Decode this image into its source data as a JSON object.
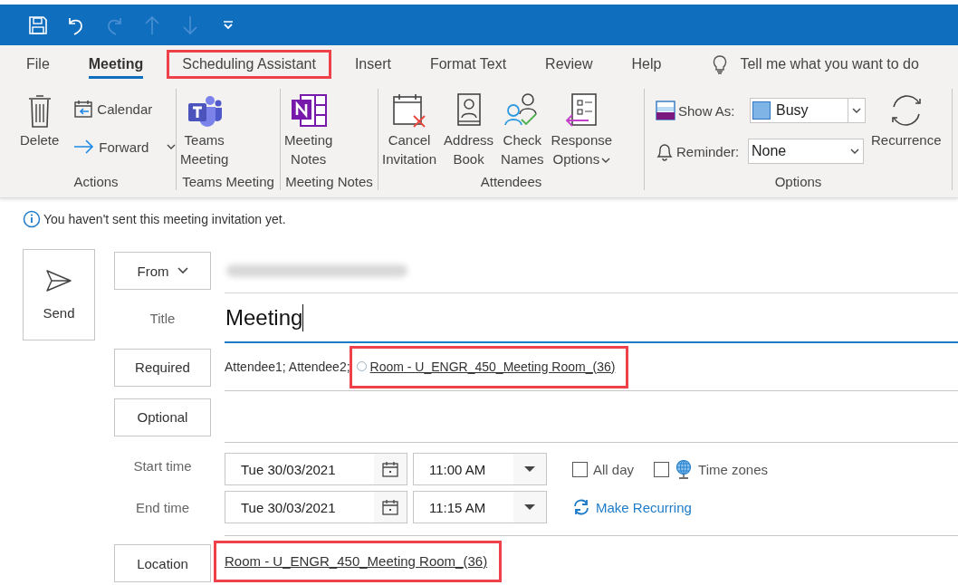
{
  "quick_access": [
    {
      "kind": "save",
      "disabled": false
    },
    {
      "kind": "undo",
      "disabled": false
    },
    {
      "kind": "redo",
      "disabled": true
    },
    {
      "kind": "up",
      "disabled": true
    },
    {
      "kind": "down",
      "disabled": true
    },
    {
      "kind": "customize",
      "disabled": false
    }
  ],
  "tabs": [
    {
      "label": "File",
      "selected": false,
      "highlighted": false
    },
    {
      "label": "Meeting",
      "selected": true,
      "highlighted": false
    },
    {
      "label": "Scheduling Assistant",
      "selected": false,
      "highlighted": true
    },
    {
      "label": "Insert",
      "selected": false,
      "highlighted": false
    },
    {
      "label": "Format Text",
      "selected": false,
      "highlighted": false
    },
    {
      "label": "Review",
      "selected": false,
      "highlighted": false
    },
    {
      "label": "Help",
      "selected": false,
      "highlighted": false
    }
  ],
  "tell_me": "Tell me what you want to do",
  "ribbon_groups": [
    {
      "label": "Actions",
      "items": [
        {
          "kind": "large",
          "label": "Delete",
          "dropdown": false
        },
        {
          "kind": "stack",
          "buttons": [
            {
              "label": "Calendar",
              "dropdown": false
            },
            {
              "label": "Forward",
              "dropdown": true
            }
          ]
        }
      ]
    },
    {
      "label": "Teams Meeting",
      "items": [
        {
          "kind": "large",
          "label": "Teams Meeting",
          "dropdown": false
        }
      ]
    },
    {
      "label": "Meeting Notes",
      "items": [
        {
          "kind": "large",
          "label": "Meeting Notes",
          "dropdown": false
        }
      ]
    },
    {
      "label": "Attendees",
      "items": [
        {
          "kind": "large",
          "label": "Cancel Invitation",
          "dropdown": false
        },
        {
          "kind": "large",
          "label": "Address Book",
          "dropdown": false
        },
        {
          "kind": "large",
          "label": "Check Names",
          "dropdown": false
        },
        {
          "kind": "large",
          "label": "Response Options",
          "dropdown": true
        }
      ]
    },
    {
      "label": "Options",
      "items": [
        {
          "kind": "combos",
          "rows": [
            {
              "label": "Show As:",
              "value": "Busy",
              "swatch": true
            },
            {
              "label": "Reminder:",
              "value": "None",
              "swatch": false
            }
          ]
        },
        {
          "kind": "large",
          "label": "Recurrence",
          "dropdown": false
        }
      ]
    }
  ],
  "info_message": "You haven't sent this meeting invitation yet.",
  "send_button": "Send",
  "from_button": "From",
  "title_label": "Title",
  "title_value": "Meeting",
  "required": {
    "button": "Required",
    "attendees": "Attendee1; Attendee2;",
    "room": "Room - U_ENGR_450_Meeting Room_(36)",
    "highlighted": true
  },
  "optional": {
    "button": "Optional"
  },
  "start_time": {
    "label": "Start time",
    "date": "Tue 30/03/2021",
    "time": "11:00 AM"
  },
  "end_time": {
    "label": "End time",
    "date": "Tue 30/03/2021",
    "time": "11:15 AM"
  },
  "all_day": {
    "label": "All day",
    "checked": false
  },
  "time_zones": {
    "label": "Time zones",
    "checked": false
  },
  "make_recurring": "Make Recurring",
  "location": {
    "button": "Location",
    "value": "Room - U_ENGR_450_Meeting Room_(36)",
    "highlighted": true
  }
}
